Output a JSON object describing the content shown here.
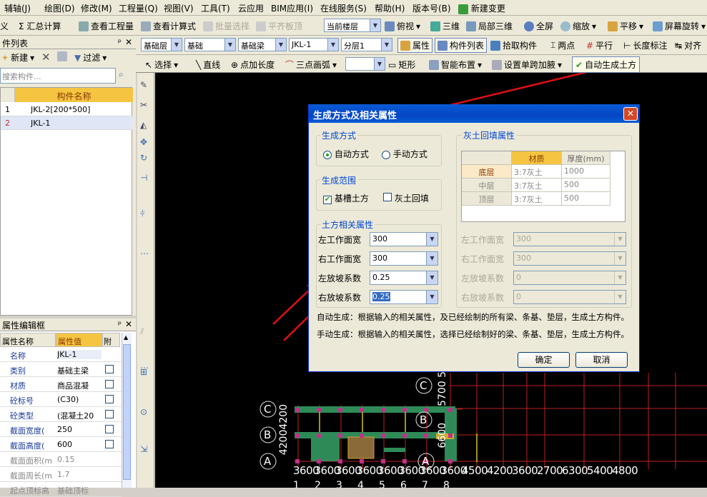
{
  "menu": [
    "辅轴(J)",
    "绘图(D)",
    "修改(M)",
    "工程量(Q)",
    "视图(V)",
    "工具(T)",
    "云应用",
    "BIM应用(I)",
    "在线服务(S)",
    "帮助(H)",
    "版本号(B)",
    "新建变更"
  ],
  "toolbar1": {
    "t0": "义",
    "t1": "Σ 汇总计算",
    "t2": "查看工程量",
    "t3": "查看计算式",
    "t4": "批量选择",
    "t5": "平齐板顶",
    "floor": "当前楼层",
    "view": "俯视",
    "threed": "三维",
    "local3d": "局部三维",
    "full": "全屏",
    "zoom": "缩放",
    "pan": "平移",
    "rotate": "屏幕旋转"
  },
  "toolbar2": {
    "layer": "基础层",
    "cat": "基础",
    "type": "基础梁",
    "comp": "JKL-1",
    "sub": "分层1",
    "attr": "属性",
    "list": "构件列表",
    "pick": "拾取构件",
    "twopt": "两点",
    "parallel": "平行",
    "length": "长度标注",
    "align": "对齐"
  },
  "toolbar3": {
    "select": "选择",
    "line": "直线",
    "ptlen": "点加长度",
    "arc": "三点画弧",
    "rect": "矩形",
    "smart": "智能布置",
    "span": "设置单跨加腋",
    "auto": "自动生成土方"
  },
  "comp_panel": {
    "title": "件列表",
    "new": "新建",
    "filter": "过滤",
    "search_ph": "搜索构件...",
    "col": "构件名称",
    "rows": [
      {
        "n": "1",
        "name": "JKL-2[200*500]"
      },
      {
        "n": "2",
        "name": "JKL-1"
      }
    ]
  },
  "prop_panel": {
    "title": "属性编辑框",
    "h1": "属性名称",
    "h2": "属性值",
    "h3": "附加",
    "rows": [
      {
        "name": "名称",
        "val": "JKL-1"
      },
      {
        "name": "类别",
        "val": "基础主梁"
      },
      {
        "name": "材质",
        "val": "商品混凝"
      },
      {
        "name": "砼标号",
        "val": "(C30)"
      },
      {
        "name": "砼类型",
        "val": "(混凝土20"
      },
      {
        "name": "截面宽度(",
        "val": "250"
      },
      {
        "name": "截面高度(",
        "val": "600"
      },
      {
        "name": "截面面积(m",
        "val": "0.15"
      },
      {
        "name": "截面周长(m",
        "val": "1.7"
      },
      {
        "name": "起点顶标高",
        "val": "基础顶标"
      }
    ]
  },
  "vtools": [
    "延伸",
    "修剪",
    "打断",
    "合并",
    "分割",
    "对齐",
    "偏移",
    "拉伸"
  ],
  "dialog": {
    "title": "生成方式及相关属性",
    "gen_mode": "生成方式",
    "auto": "自动方式",
    "manual": "手动方式",
    "range": "生成范围",
    "trench": "基槽土方",
    "backfill": "灰土回填",
    "earth": "土方相关属性",
    "left_w": "左工作面宽",
    "right_w": "右工作面宽",
    "left_s": "左放坡系数",
    "right_s": "右放坡系数",
    "v_left_w": "300",
    "v_right_w": "300",
    "v_left_s": "0.25",
    "v_right_s": "0.25",
    "fill_props": "灰土回填属性",
    "th_mat": "材质",
    "th_thk": "厚度(mm)",
    "fill_rows": [
      {
        "l": "底层",
        "m": "3:7灰土",
        "t": "1000"
      },
      {
        "l": "中层",
        "m": "3:7灰土",
        "t": "500"
      },
      {
        "l": "顶层",
        "m": "3:7灰土",
        "t": "500"
      }
    ],
    "d_left_w": "300",
    "d_right_w": "300",
    "d_left_s": "0",
    "d_right_s": "0",
    "note1": "自动生成：根据输入的相关属性，及已经绘制的所有梁、条基、垫层，生成土方构件。",
    "note2": "手动生成：根据输入的相关属性，选择已经绘制好的梁、条基、垫层，生成土方构件。",
    "ok": "确定",
    "cancel": "取消"
  },
  "cad": {
    "axisA": "A",
    "axisB": "B",
    "axisC": "C",
    "dims_left": "4200",
    "dims_left2": "4200",
    "dim_r1": "5700",
    "dim_r2": "5",
    "dim_r3": "6600",
    "bottom": [
      "3600",
      "3600",
      "3600",
      "3600",
      "3600",
      "3600",
      "3600",
      "3600",
      "4500",
      "4200",
      "3600",
      "2700",
      "6300",
      "5400",
      "4800"
    ],
    "bnums": [
      "1",
      "2",
      "3",
      "4",
      "5",
      "6",
      "7",
      "8"
    ]
  }
}
